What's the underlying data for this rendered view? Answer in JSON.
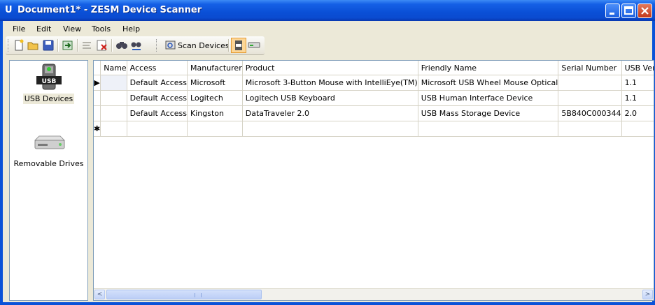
{
  "window": {
    "title": "Document1* - ZESM Device Scanner",
    "app_icon": "U"
  },
  "title_buttons": {
    "minimize": "_",
    "maximize": "□",
    "close": "✕"
  },
  "menu": [
    {
      "label": "File"
    },
    {
      "label": "Edit"
    },
    {
      "label": "View"
    },
    {
      "label": "Tools"
    },
    {
      "label": "Help"
    }
  ],
  "toolbar": {
    "icons": [
      "new-icon",
      "open-icon",
      "save-icon",
      "import-icon",
      "edit-disabled-icon",
      "delete-icon",
      "find-icon",
      "find-next-icon"
    ],
    "scan_label": "Scan Devices"
  },
  "left_panel": {
    "items": [
      {
        "label": "USB Devices",
        "icon": "usb-drive-icon",
        "badge": "USB",
        "selected": true
      },
      {
        "label": "Removable Drives",
        "icon": "removable-drive-icon",
        "selected": false
      }
    ]
  },
  "grid": {
    "columns": [
      "Name",
      "Access",
      "Manufacturer",
      "Product",
      "Friendly Name",
      "Serial Number",
      "USB Version"
    ],
    "rows": [
      {
        "marker": "▶",
        "name": "",
        "access": "Default Access",
        "manufacturer": "Microsoft",
        "product": "Microsoft 3-Button Mouse with IntelliEye(TM)",
        "friendly": "Microsoft USB Wheel Mouse Optical",
        "serial": "",
        "usb": "1.1"
      },
      {
        "marker": "",
        "name": "",
        "access": "Default Access",
        "manufacturer": "Logitech",
        "product": "Logitech USB Keyboard",
        "friendly": "USB Human Interface Device",
        "serial": "",
        "usb": "1.1"
      },
      {
        "marker": "",
        "name": "",
        "access": "Default Access",
        "manufacturer": "Kingston",
        "product": "DataTraveler 2.0",
        "friendly": "USB Mass Storage Device",
        "serial": "5B840C000344",
        "usb": "2.0"
      }
    ],
    "new_row_marker": "✱"
  },
  "scrollbar": {
    "left": "<",
    "right": ">"
  },
  "colors": {
    "title_blue": "#0a4fd6",
    "accent_orange": "#e39a31",
    "panel_border": "#7f9db9"
  }
}
